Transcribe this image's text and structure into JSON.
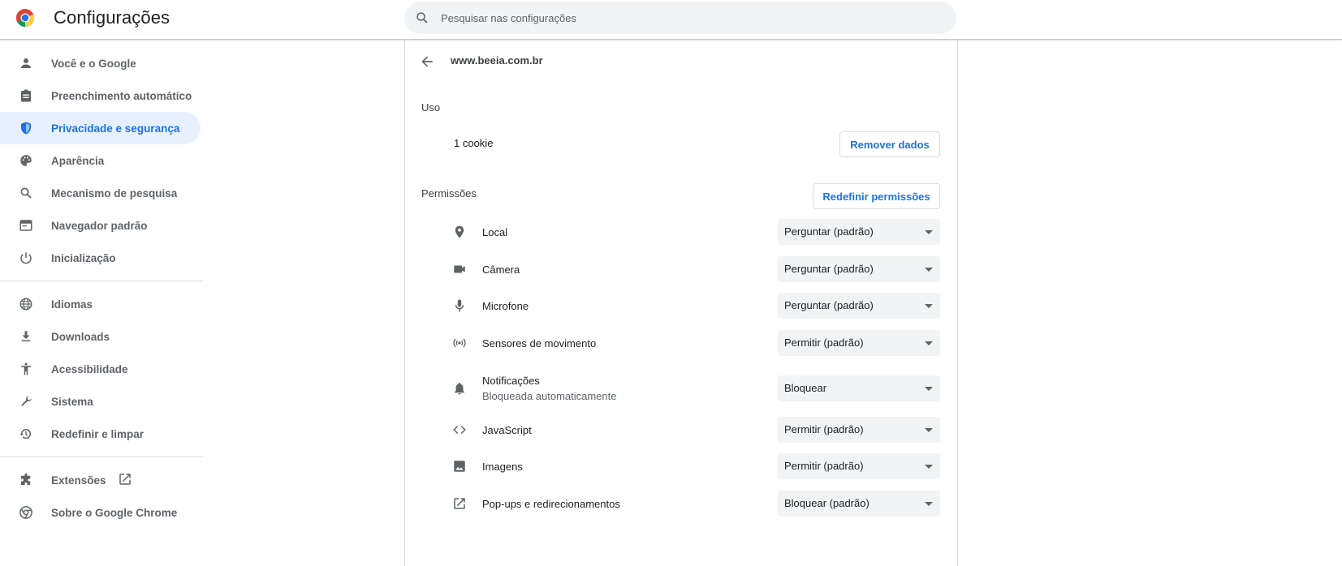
{
  "header": {
    "title": "Configurações",
    "logo_icon": "chrome-logo-icon",
    "search_placeholder": "Pesquisar nas configurações",
    "search_icon": "search-icon"
  },
  "sidebar": {
    "groups": [
      [
        {
          "label": "Você e o Google",
          "icon": "person-icon"
        },
        {
          "label": "Preenchimento automático",
          "icon": "clipboard-icon"
        },
        {
          "label": "Privacidade e segurança",
          "icon": "shield-icon",
          "active": true
        },
        {
          "label": "Aparência",
          "icon": "palette-icon"
        },
        {
          "label": "Mecanismo de pesquisa",
          "icon": "search-icon"
        },
        {
          "label": "Navegador padrão",
          "icon": "browser-window-icon"
        },
        {
          "label": "Inicialização",
          "icon": "power-icon"
        }
      ],
      [
        {
          "label": "Idiomas",
          "icon": "globe-icon"
        },
        {
          "label": "Downloads",
          "icon": "download-icon"
        },
        {
          "label": "Acessibilidade",
          "icon": "accessibility-icon"
        },
        {
          "label": "Sistema",
          "icon": "wrench-icon"
        },
        {
          "label": "Redefinir e limpar",
          "icon": "history-icon"
        }
      ],
      [
        {
          "label": "Extensões",
          "icon": "puzzle-icon",
          "external": true
        },
        {
          "label": "Sobre o Google Chrome",
          "icon": "chrome-icon"
        }
      ]
    ]
  },
  "site": {
    "title": "www.beeia.com.br",
    "usage_label": "Uso",
    "cookie_text": "1 cookie",
    "remove_button": "Remover dados",
    "permissions_label": "Permissões",
    "reset_button": "Redefinir permissões",
    "permissions": [
      {
        "label": "Local",
        "icon": "location-pin-icon",
        "value": "Perguntar (padrão)"
      },
      {
        "label": "Câmera",
        "icon": "camera-icon",
        "value": "Perguntar (padrão)"
      },
      {
        "label": "Microfone",
        "icon": "microphone-icon",
        "value": "Perguntar (padrão)"
      },
      {
        "label": "Sensores de movimento",
        "icon": "motion-sensor-icon",
        "value": "Permitir (padrão)"
      },
      {
        "label": "Notificações",
        "sublabel": "Bloqueada automaticamente",
        "icon": "bell-icon",
        "value": "Bloquear"
      },
      {
        "label": "JavaScript",
        "icon": "code-icon",
        "value": "Permitir (padrão)"
      },
      {
        "label": "Imagens",
        "icon": "image-icon",
        "value": "Permitir (padrão)"
      },
      {
        "label": "Pop-ups e redirecionamentos",
        "icon": "open-external-icon",
        "value": "Bloquear (padrão)"
      }
    ]
  },
  "colors": {
    "accent": "#1a73e8",
    "active_bg": "#e8f0fe",
    "icon_gray": "#5f6368",
    "field_bg": "#f1f3f4"
  }
}
